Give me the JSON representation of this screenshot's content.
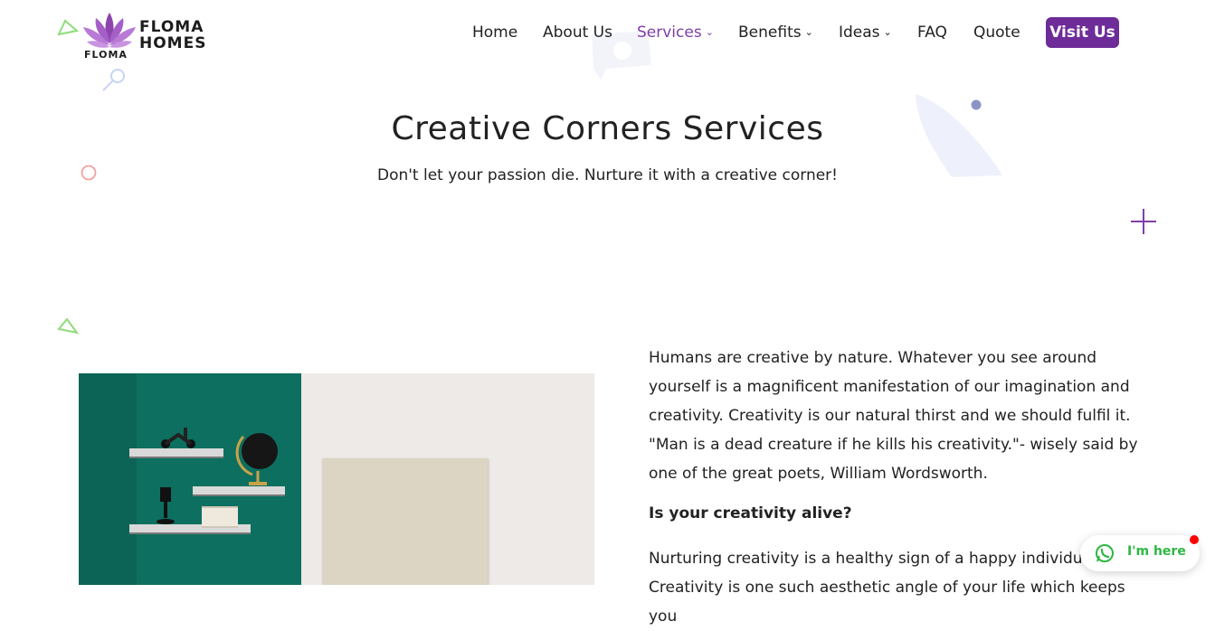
{
  "brand": {
    "line1": "FLOMA",
    "line2": "HOMES",
    "line3": "FLOMA",
    "accent": "#7e3fa8"
  },
  "nav": {
    "items": [
      {
        "label": "Home",
        "has_dropdown": false
      },
      {
        "label": "About Us",
        "has_dropdown": false
      },
      {
        "label": "Services",
        "has_dropdown": true,
        "active": true
      },
      {
        "label": "Benefits",
        "has_dropdown": true
      },
      {
        "label": "Ideas",
        "has_dropdown": true
      },
      {
        "label": "FAQ",
        "has_dropdown": false
      },
      {
        "label": "Quote",
        "has_dropdown": false
      }
    ],
    "cta_label": "Visit Us",
    "chevron_icon": "chevron-down-icon"
  },
  "hero": {
    "title": "Creative Corners Services",
    "subtitle": "Don't let your passion die. Nurture it with a creative corner!"
  },
  "content": {
    "paragraph1": "Humans are creative by nature. Whatever you see around yourself is a magnificent manifestation of our imagination and creativity. Creativity is our natural thirst and we should fulfil it. \"Man is a dead creature if he kills his creativity.\"- wisely said by one of the great poets, William Wordsworth.",
    "heading": "Is your creativity alive?",
    "paragraph2": "Nurturing creativity is a healthy sign of a happy individual. Creativity is one such aesthetic angle of your life which keeps you"
  },
  "chat_widget": {
    "label": "I'm here",
    "icon": "whatsapp-icon",
    "color": "#2db742"
  },
  "colors": {
    "cta_bg": "#6d2c98",
    "active_nav": "#7e3fa8"
  }
}
